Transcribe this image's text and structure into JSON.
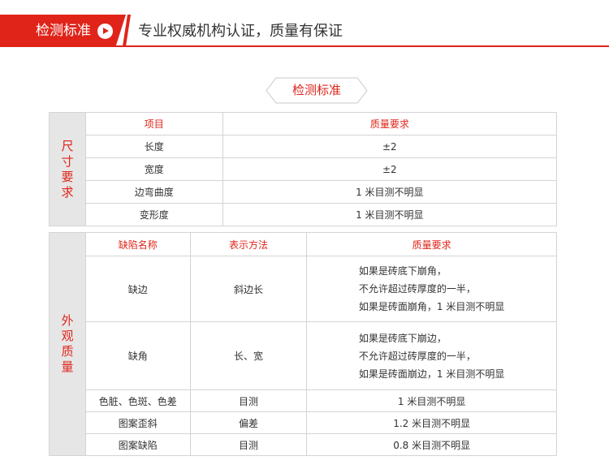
{
  "header": {
    "badge_label": "检测标准",
    "subtitle": "专业权威机构认证，质量有保证",
    "play_icon": "play-icon",
    "accent_color": "#e0241a"
  },
  "section_tag": {
    "label": "检测标准"
  },
  "size_table": {
    "side_label": [
      "尺",
      "寸",
      "要",
      "求"
    ],
    "headers": [
      "项目",
      "质量要求"
    ],
    "rows": [
      [
        "长度",
        "±2"
      ],
      [
        "宽度",
        "±2"
      ],
      [
        "边弯曲度",
        "1 米目测不明显"
      ],
      [
        "变形度",
        "1 米目测不明显"
      ]
    ]
  },
  "appearance_table": {
    "side_label": [
      "外",
      "观",
      "质",
      "量"
    ],
    "headers": [
      "缺陷名称",
      "表示方法",
      "质量要求"
    ],
    "rows": [
      [
        "缺边",
        "斜边长",
        [
          "如果是砖底下崩角，",
          "不允许超过砖厚度的一半，",
          "如果是砖面崩角，1 米目测不明显"
        ]
      ],
      [
        "缺角",
        "长、宽",
        [
          "如果是砖底下崩边，",
          "不允许超过砖厚度的一半，",
          "如果是砖面崩边，1 米目测不明显"
        ]
      ],
      [
        "色脏、色斑、色差",
        "目测",
        "1 米目测不明显"
      ],
      [
        "图案歪斜",
        "偏差",
        "1.2 米目测不明显"
      ],
      [
        "图案缺陷",
        "目测",
        "0.8 米目测不明显"
      ]
    ]
  }
}
